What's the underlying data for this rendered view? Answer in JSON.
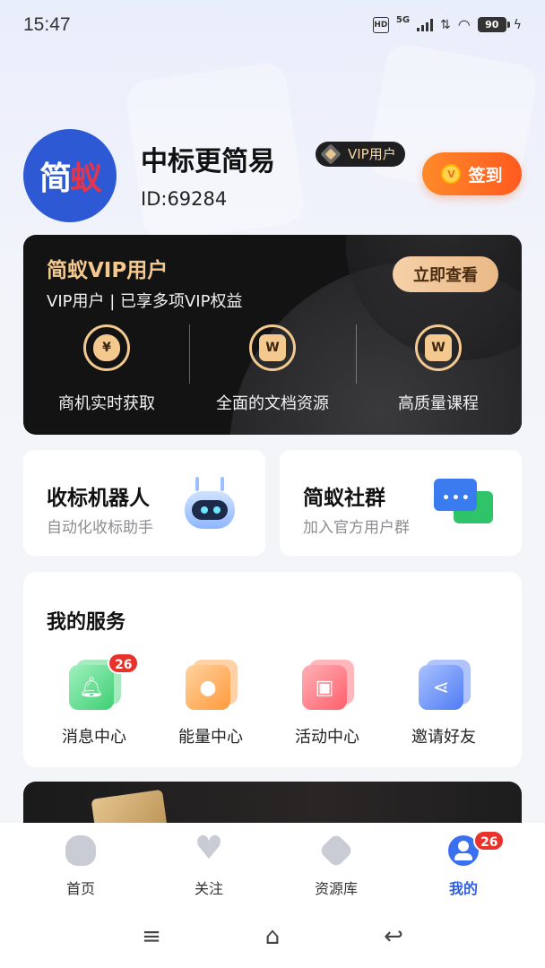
{
  "status_bar": {
    "time": "15:47",
    "hd": "HD",
    "network": "5G",
    "battery": "90"
  },
  "profile": {
    "avatar_text_a": "简",
    "avatar_text_b": "蚁",
    "name": "中标更简易",
    "id_text": "ID:69284",
    "vip_badge": "VIP用户",
    "signin_label": "签到"
  },
  "vip_card": {
    "title": "简蚁VIP用户",
    "subtitle": "VIP用户 | 已享多项VIP权益",
    "view_button": "立即查看",
    "features": [
      {
        "label": "商机实时获取",
        "icon": "money-bag-icon",
        "glyph": "¥"
      },
      {
        "label": "全面的文档资源",
        "icon": "document-icon",
        "glyph": "W"
      },
      {
        "label": "高质量课程",
        "icon": "course-icon",
        "glyph": "W"
      }
    ],
    "accent": "#f3c98f"
  },
  "quick_cards": [
    {
      "title": "收标机器人",
      "subtitle": "自动化收标助手",
      "icon": "robot-icon"
    },
    {
      "title": "简蚁社群",
      "subtitle": "加入官方用户群",
      "icon": "chat-bubbles-icon"
    }
  ],
  "services": {
    "title": "我的服务",
    "items": [
      {
        "label": "消息中心",
        "icon": "bell-icon",
        "badge": "26",
        "color": "#3fcf74"
      },
      {
        "label": "能量中心",
        "icon": "energy-drop-icon",
        "color": "#ff9a3c"
      },
      {
        "label": "活动中心",
        "icon": "gift-icon",
        "color": "#ff5f6a"
      },
      {
        "label": "邀请好友",
        "icon": "share-icon",
        "color": "#4f7cf4"
      }
    ]
  },
  "bottom_nav": {
    "items": [
      {
        "label": "首页",
        "icon": "home-icon"
      },
      {
        "label": "关注",
        "icon": "heart-icon"
      },
      {
        "label": "资源库",
        "icon": "resource-icon"
      },
      {
        "label": "我的",
        "icon": "profile-icon",
        "badge": "26",
        "active": true
      }
    ],
    "active_color": "#2e5fe0"
  },
  "system_nav": {
    "menu": "≡",
    "home": "⌂",
    "back": "↩"
  }
}
